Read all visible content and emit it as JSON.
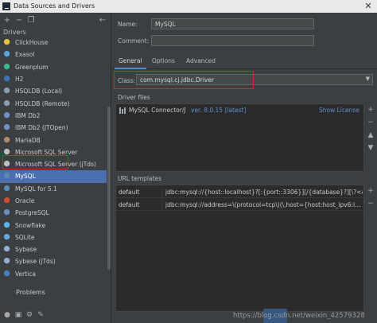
{
  "window": {
    "title": "Data Sources and Drivers",
    "close_glyph": "✕"
  },
  "left": {
    "toolbar": {
      "add_glyph": "+",
      "remove_glyph": "−",
      "copy_glyph": "❐",
      "back_glyph": "←"
    },
    "drivers_heading": "Drivers",
    "drivers": [
      {
        "label": "ClickHouse",
        "icon": "clickhouse-icon",
        "color": "#e8c63c"
      },
      {
        "label": "Exasol",
        "icon": "exasol-icon",
        "color": "#5aa4d8"
      },
      {
        "label": "Greenplum",
        "icon": "greenplum-icon",
        "color": "#3fb58c"
      },
      {
        "label": "H2",
        "icon": "h2-icon",
        "color": "#3b73b9"
      },
      {
        "label": "HSQLDB (Local)",
        "icon": "hsqldb-icon",
        "color": "#8a9bb0"
      },
      {
        "label": "HSQLDB (Remote)",
        "icon": "hsqldb-icon",
        "color": "#8a9bb0"
      },
      {
        "label": "IBM Db2",
        "icon": "ibm-icon",
        "color": "#6f8fcf"
      },
      {
        "label": "IBM Db2 (JTOpen)",
        "icon": "ibm-icon",
        "color": "#6f8fcf"
      },
      {
        "label": "MariaDB",
        "icon": "mariadb-icon",
        "color": "#b08a6a"
      },
      {
        "label": "Microsoft SQL Server",
        "icon": "sqlserver-icon",
        "color": "#c0c0c0"
      },
      {
        "label": "Microsoft SQL Server (jTds)",
        "icon": "sqlserver-icon",
        "color": "#c0c0c0"
      },
      {
        "label": "MySQL",
        "icon": "mysql-icon",
        "color": "#5b8bb0"
      },
      {
        "label": "MySQL for 5.1",
        "icon": "mysql-icon",
        "color": "#5b8bb0"
      },
      {
        "label": "Oracle",
        "icon": "oracle-icon",
        "color": "#d04a3a"
      },
      {
        "label": "PostgreSQL",
        "icon": "postgresql-icon",
        "color": "#6a8fbf"
      },
      {
        "label": "Snowflake",
        "icon": "snowflake-icon",
        "color": "#5ab6e8"
      },
      {
        "label": "SQLite",
        "icon": "sqlite-icon",
        "color": "#6aa8d8"
      },
      {
        "label": "Sybase",
        "icon": "sybase-icon",
        "color": "#8fb0d0"
      },
      {
        "label": "Sybase (jTds)",
        "icon": "sybase-icon",
        "color": "#8fb0d0"
      },
      {
        "label": "Vertica",
        "icon": "vertica-icon",
        "color": "#4a7fc0"
      }
    ],
    "selected_index": 11,
    "problems_label": "Problems"
  },
  "right": {
    "name_label": "Name:",
    "name_value": "MySQL",
    "comment_label": "Comment:",
    "comment_value": "",
    "tabs": [
      "General",
      "Options",
      "Advanced"
    ],
    "class_label": "Class:",
    "class_value": "com.mysql.cj.jdbc.Driver",
    "driver_files_label": "Driver files",
    "driver_file": {
      "name": "MySQL Connector/J",
      "version": "ver. 8.0.15 [latest]",
      "show_license": "Show License"
    },
    "url_templates_label": "URL templates",
    "url_templates": [
      {
        "name": "default",
        "url": "jdbc:mysql://{host::localhost}?[:{port::3306}][/{database}?][\\?<&,user…"
      },
      {
        "name": "default",
        "url": "jdbc:mysql://address=\\(protocol=tcp\\)(\\,host={host:host_ipv6:l…"
      }
    ]
  },
  "watermark": "https://blog.csdn.net/weixin_42579328",
  "colors": {
    "background": "#3c3f41",
    "selection": "#4b6eaf",
    "link": "#5f8dd3",
    "highlight_box": "#d02a2a"
  }
}
